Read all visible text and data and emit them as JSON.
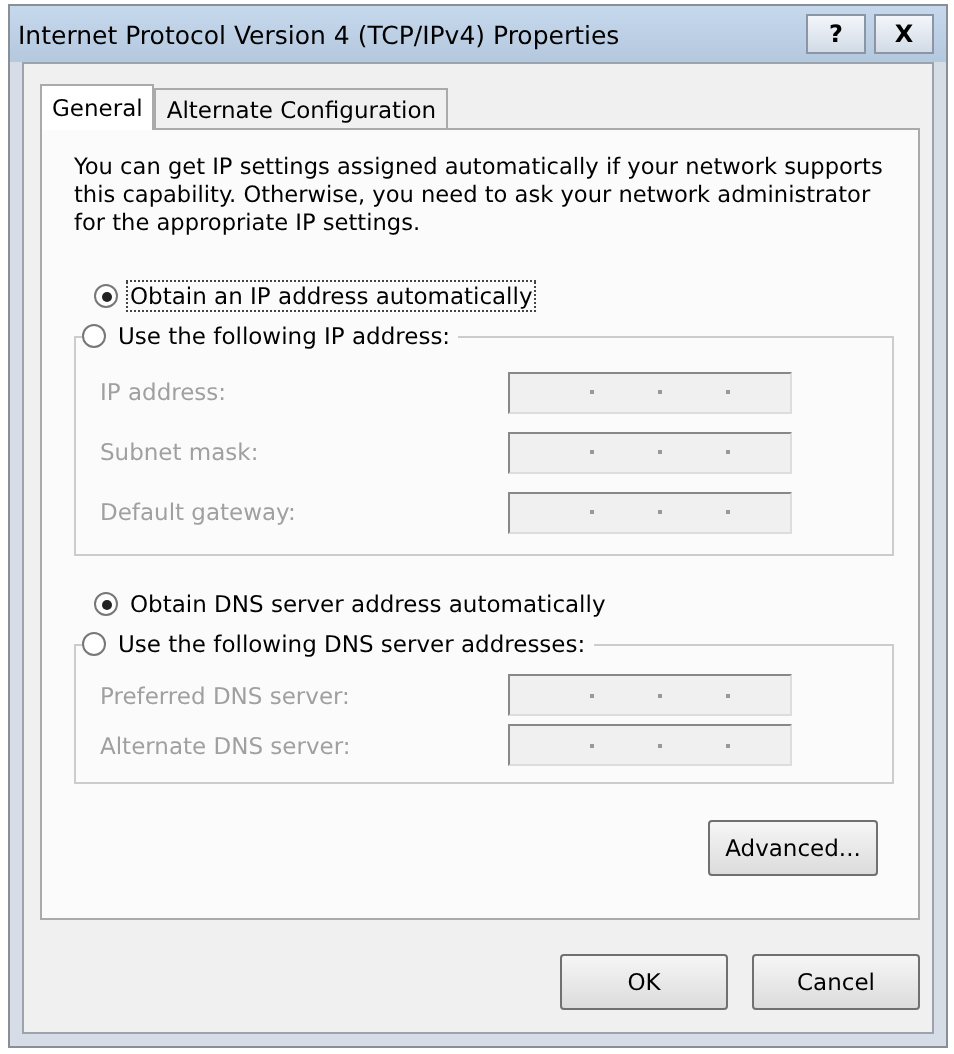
{
  "window": {
    "title": "Internet Protocol Version 4 (TCP/IPv4) Properties",
    "help_button": "?",
    "close_button": "X"
  },
  "tabs": [
    {
      "label": "General",
      "selected": true
    },
    {
      "label": "Alternate Configuration",
      "selected": false
    }
  ],
  "intro": "You can get IP settings assigned automatically if your network supports this capability. Otherwise, you need to ask your network administrator for the appropriate IP settings.",
  "ip_section": {
    "auto_option": {
      "label": "Obtain an IP address automatically",
      "selected": true,
      "focused": true
    },
    "manual_option": {
      "label": "Use the following IP address:",
      "selected": false,
      "focused": false
    },
    "fields": [
      {
        "label": "IP address:",
        "disabled": true
      },
      {
        "label": "Subnet mask:",
        "disabled": true
      },
      {
        "label": "Default gateway:",
        "disabled": true
      }
    ]
  },
  "dns_section": {
    "auto_option": {
      "label": "Obtain DNS server address automatically",
      "selected": true,
      "focused": false
    },
    "manual_option": {
      "label": "Use the following DNS server addresses:",
      "selected": false,
      "focused": false
    },
    "fields": [
      {
        "label": "Preferred DNS server:",
        "disabled": true
      },
      {
        "label": "Alternate DNS server:",
        "disabled": true
      }
    ]
  },
  "advanced_button": "Advanced...",
  "buttons": [
    "OK",
    "Cancel"
  ]
}
